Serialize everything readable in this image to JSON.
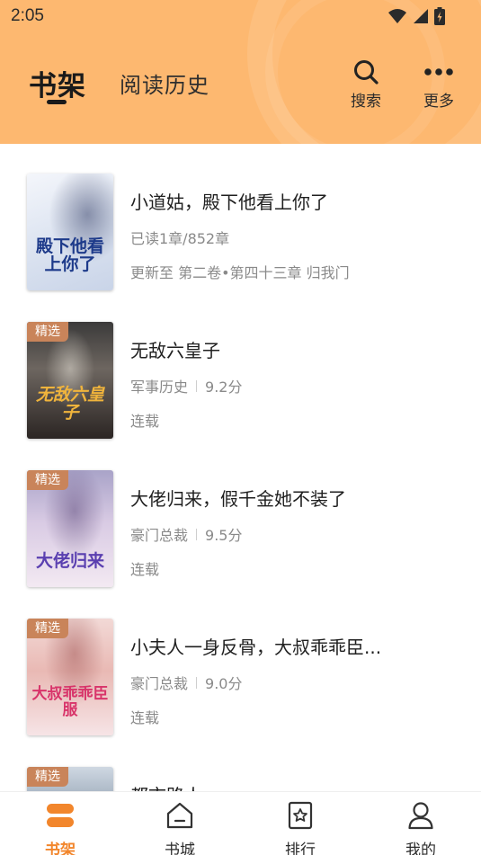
{
  "status_bar": {
    "time": "2:05"
  },
  "header": {
    "tabs": [
      {
        "label": "书架",
        "active": true
      },
      {
        "label": "阅读历史",
        "active": false
      }
    ],
    "search_label": "搜索",
    "more_label": "更多"
  },
  "books": [
    {
      "title": "小道姑，殿下他看上你了",
      "progress": "已读1章/852章",
      "update": "更新至  第二卷•第四十三章 归我门",
      "badge": "",
      "cover_text": "殿下他看上你了"
    },
    {
      "title": "无敌六皇子",
      "category": "军事历史",
      "score": "9.2分",
      "status": "连载",
      "badge": "精选",
      "cover_text": "无敌六皇子"
    },
    {
      "title": "大佬归来，假千金她不装了",
      "category": "豪门总裁",
      "score": "9.5分",
      "status": "连载",
      "badge": "精选",
      "cover_text": "大佬归来"
    },
    {
      "title": "小夫人一身反骨，大叔乖乖臣...",
      "category": "豪门总裁",
      "score": "9.0分",
      "status": "连载",
      "badge": "精选",
      "cover_text": "大叔乖乖臣服"
    },
    {
      "title": "都市路人",
      "badge": "精选"
    }
  ],
  "bottom_nav": [
    {
      "label": "书架",
      "icon": "bookshelf-icon",
      "active": true
    },
    {
      "label": "书城",
      "icon": "store-icon",
      "active": false
    },
    {
      "label": "排行",
      "icon": "ranking-icon",
      "active": false
    },
    {
      "label": "我的",
      "icon": "profile-icon",
      "active": false
    }
  ],
  "colors": {
    "header_bg": "#FDB870",
    "accent": "#F2862C",
    "badge": "#C9845A"
  }
}
